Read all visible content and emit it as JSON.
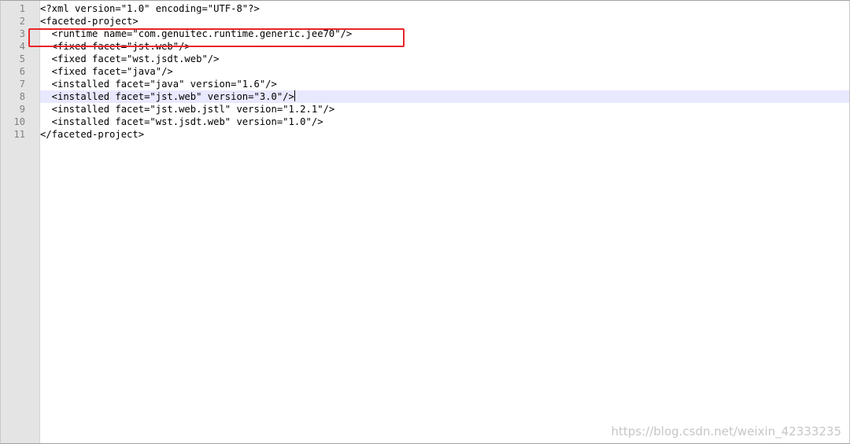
{
  "editor": {
    "line_numbers": [
      "1",
      "2",
      "3",
      "4",
      "5",
      "6",
      "7",
      "8",
      "9",
      "10",
      "11"
    ],
    "lines": [
      "<?xml version=\"1.0\" encoding=\"UTF-8\"?>",
      "<faceted-project>",
      "  <runtime name=\"com.genuitec.runtime.generic.jee70\"/>",
      "  <fixed facet=\"jst.web\"/>",
      "  <fixed facet=\"wst.jsdt.web\"/>",
      "  <fixed facet=\"java\"/>",
      "  <installed facet=\"java\" version=\"1.6\"/>",
      "  <installed facet=\"jst.web\" version=\"3.0\"/>",
      "  <installed facet=\"jst.web.jstl\" version=\"1.2.1\"/>",
      "  <installed facet=\"wst.jsdt.web\" version=\"1.0\"/>",
      "</faceted-project>"
    ],
    "current_line": 8
  },
  "annotation": {
    "color": "#e8262a",
    "target_line": 3
  },
  "watermark": "https://blog.csdn.net/weixin_42333235",
  "colors": {
    "gutter": "#e4e4e4",
    "current_line": "#e8e8ff",
    "text": "#000000",
    "line_number": "#808080"
  }
}
